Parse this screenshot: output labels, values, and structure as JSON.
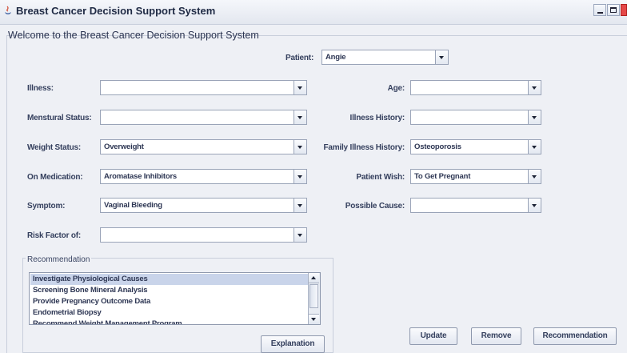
{
  "window": {
    "title": "Breast Cancer Decision Support System"
  },
  "welcome": "Welcome to the Breast Cancer Decision Support System",
  "patient": {
    "label": "Patient:",
    "value": "Angie"
  },
  "left_fields": [
    {
      "label": "Illness:",
      "value": ""
    },
    {
      "label": "Menstural Status:",
      "value": ""
    },
    {
      "label": "Weight Status:",
      "value": "Overweight"
    },
    {
      "label": "On Medication:",
      "value": "Aromatase Inhibitors"
    },
    {
      "label": "Symptom:",
      "value": "Vaginal Bleeding"
    },
    {
      "label": "Risk Factor of:",
      "value": ""
    }
  ],
  "right_fields": [
    {
      "label": "Age:",
      "value": ""
    },
    {
      "label": "Illness History:",
      "value": ""
    },
    {
      "label": "Family Illness History:",
      "value": "Osteoporosis"
    },
    {
      "label": "Patient Wish:",
      "value": "To Get Pregnant"
    },
    {
      "label": "Possible Cause:",
      "value": ""
    }
  ],
  "recommendation": {
    "title": "Recommendation",
    "items": [
      "Investigate Physiological Causes",
      "Screening Bone Mineral Analysis",
      "Provide Pregnancy Outcome Data",
      "Endometrial Biopsy",
      "Recommend Weight Management Program"
    ],
    "selected_index": 0
  },
  "buttons": {
    "explanation": "Explanation",
    "update": "Update",
    "remove": "Remove",
    "recommendation": "Recommendation"
  },
  "colors": {
    "selection": "#c9d4ea",
    "close_button": "#e54848"
  }
}
